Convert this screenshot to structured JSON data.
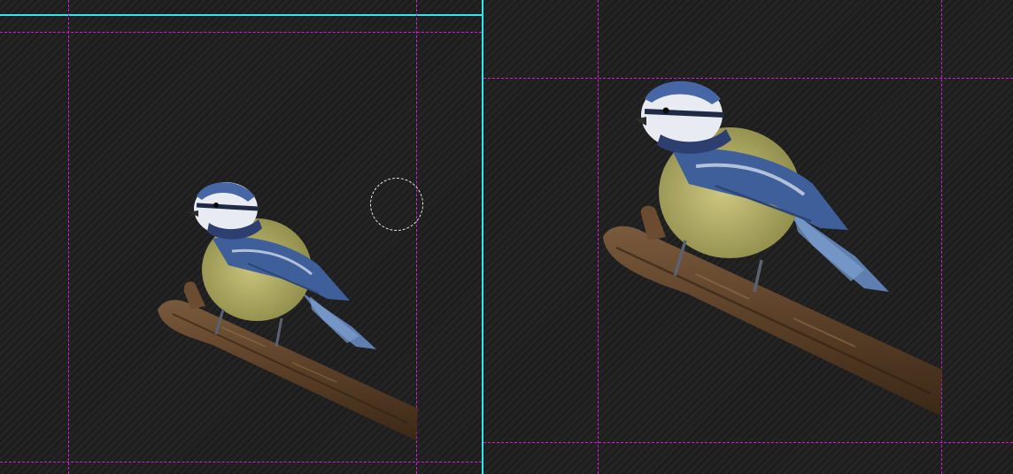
{
  "canvas": {
    "left_view": {
      "name": "bird-on-branch-preview-left"
    },
    "right_view": {
      "name": "bird-on-branch-preview-right"
    },
    "guide_color": "#d21ed2",
    "divider_color": "#34e4ec",
    "tool": {
      "name": "brush-cursor"
    }
  }
}
